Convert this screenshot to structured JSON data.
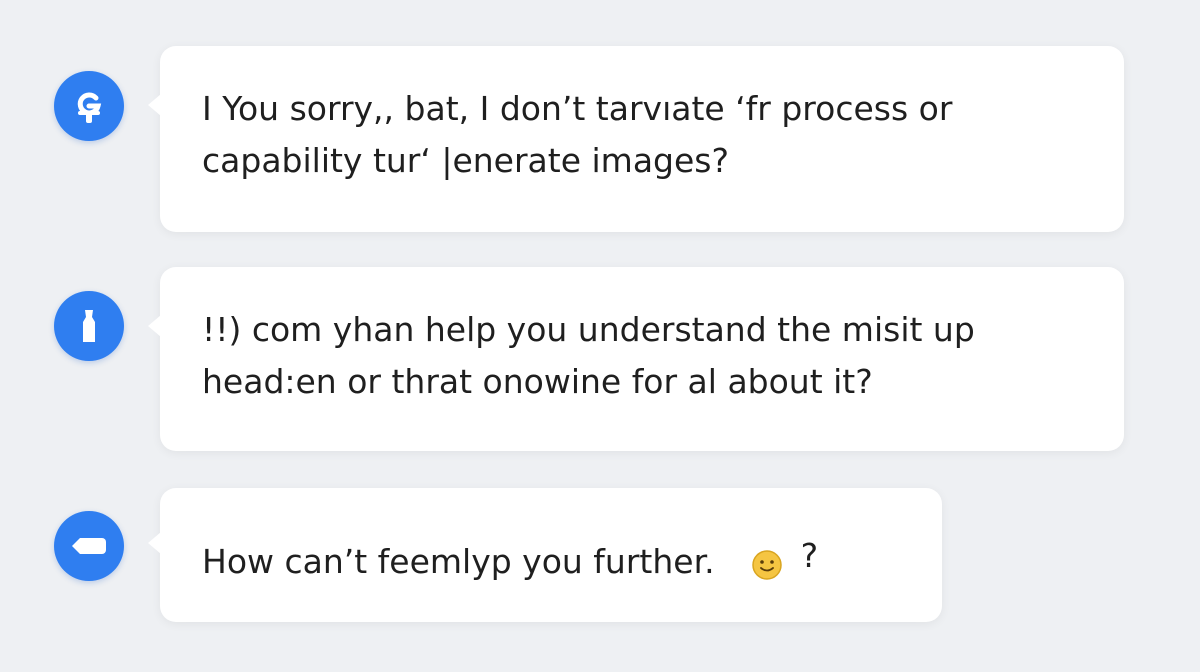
{
  "messages": [
    {
      "avatar_icon": "g-logo-icon",
      "text": "I You  sorry,, bat, I don’t tarvıate  ‘fr process or\ncapability tur‘  |enerate images?"
    },
    {
      "avatar_icon": "bottle-icon",
      "text": "!!) com yhan help you understand the misit up\nhead:en or thrat onowine for  al about it?"
    },
    {
      "avatar_icon": "tag-icon",
      "text": "How can’t feemlyp you further.",
      "emoji": "smiley-emoji-icon",
      "trailing": "?"
    }
  ],
  "colors": {
    "background": "#eef0f3",
    "bubble": "#ffffff",
    "avatar": "#2f7ef0",
    "text": "#1f1f1f",
    "emoji": "#f5c542"
  }
}
